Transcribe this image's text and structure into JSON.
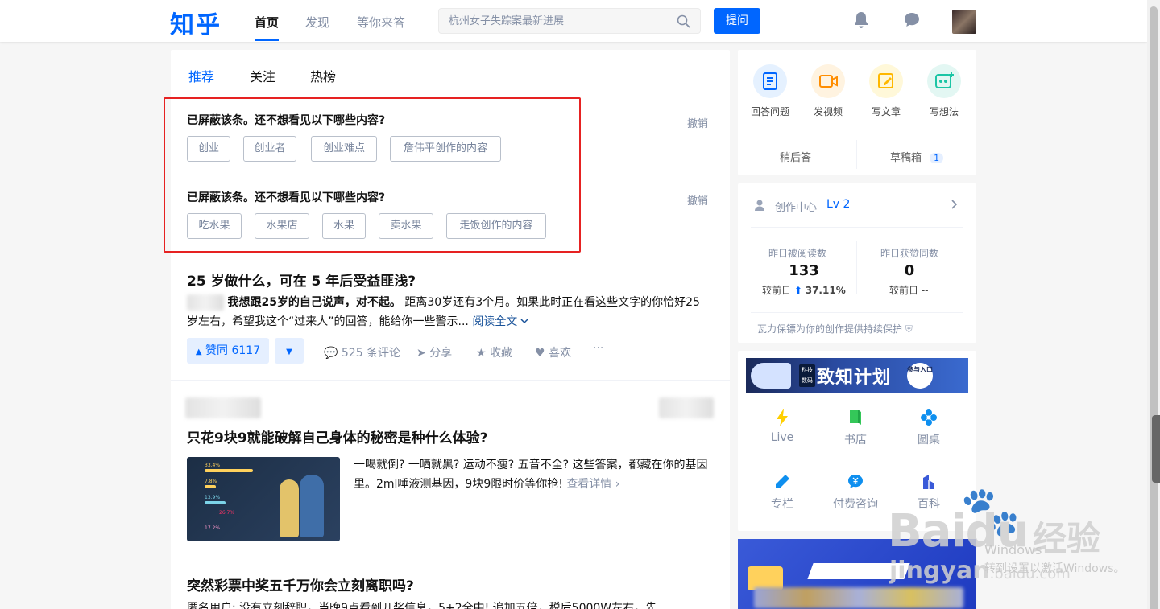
{
  "header": {
    "logo": "知乎",
    "nav": [
      "首页",
      "发现",
      "等你来答"
    ],
    "search_placeholder": "杭州女子失踪案最新进展",
    "ask_label": "提问",
    "icons": [
      "search-icon",
      "bell-icon",
      "chat-icon"
    ]
  },
  "feed": {
    "tabs": [
      "推荐",
      "关注",
      "热榜"
    ],
    "blocked": [
      {
        "title": "已屏蔽该条。还不想看见以下哪些内容?",
        "undo": "撤销",
        "chips": [
          "创业",
          "创业者",
          "创业难点",
          "詹伟平创作的内容"
        ]
      },
      {
        "title": "已屏蔽该条。还不想看见以下哪些内容?",
        "undo": "撤销",
        "chips": [
          "吃水果",
          "水果店",
          "水果",
          "卖水果",
          "走饭创作的内容"
        ]
      }
    ],
    "items": [
      {
        "title": "25 岁做什么，可在 5 年后受益匪浅?",
        "excerpt_bold": "我想跟25岁的自己说声，对不起。",
        "excerpt": " 距离30岁还有3个月。如果此时正在看这些文字的你恰好25岁左右，希望我这个“过来人”的回答，能给你一些警示...",
        "read_more": "阅读全文",
        "vote": "赞同 6117",
        "comments": "525 条评论",
        "share": "分享",
        "collect": "收藏",
        "like": "喜欢",
        "more": "···"
      },
      {
        "title": "只花9块9就能破解自己身体的秘密是种什么体验?",
        "excerpt": "一喝就倒? 一晒就黑? 运动不瘦? 五音不全? 这些答案，都藏在你的基因里。2ml唾液测基因，9块9限时价等你抢! ",
        "detail": "查看详情",
        "thumb_stats": [
          "33.4%",
          "7.8%",
          "13.9%",
          "26.7%",
          "17.2%"
        ]
      },
      {
        "title": "突然彩票中奖五千万你会立刻离职吗?",
        "excerpt": "匿名用户: 没有立刻辞职，当晚9点看到开奖信息，5+2全中! 追加五倍，税后5000W左右，先"
      }
    ]
  },
  "sidebar": {
    "tools": [
      {
        "label": "回答问题",
        "color": "#e5f1ff",
        "icon": "answer-icon"
      },
      {
        "label": "发视频",
        "color": "#fff3e0",
        "icon": "video-icon"
      },
      {
        "label": "写文章",
        "color": "#fff8d9",
        "icon": "edit-icon"
      },
      {
        "label": "写想法",
        "color": "#e3f7f3",
        "icon": "idea-icon"
      }
    ],
    "later": "稍后答",
    "drafts": "草稿箱",
    "drafts_count": "1",
    "creator": {
      "label": "创作中心",
      "level": "Lv 2",
      "reads_label": "昨日被阅读数",
      "reads": "133",
      "reads_cmp_label": "较前日",
      "reads_cmp": "37.11%",
      "likes_label": "昨日获赞同数",
      "likes": "0",
      "likes_cmp_label": "较前日",
      "likes_cmp": "--",
      "protect": "瓦力保镖为你的创作提供持续保护"
    },
    "banner": {
      "tag": "科技数码",
      "text": "致知计划",
      "cta": "参与入口"
    },
    "grid": [
      {
        "label": "Live",
        "icon": "lightning-icon",
        "color": "#ffcf00"
      },
      {
        "label": "书店",
        "icon": "book-icon",
        "color": "#34c759"
      },
      {
        "label": "圆桌",
        "icon": "roundtable-icon",
        "color": "#0e8fef"
      },
      {
        "label": "专栏",
        "icon": "pen-icon",
        "color": "#0e8fef"
      },
      {
        "label": "付费咨询",
        "icon": "paid-consult-icon",
        "color": "#0e8fef"
      },
      {
        "label": "百科",
        "icon": "wiki-icon",
        "color": "#3a5ad8"
      }
    ]
  },
  "watermark": {
    "brand": "Bai",
    "brand2": "du",
    "jing": "经验",
    "sub": "jingyan",
    "sub_tail": ".baidu.com"
  },
  "os_overlay": {
    "line1": "Windows",
    "line2": "转到设置以激活Windows。"
  },
  "colors": {
    "brand": "#0066ff",
    "highlight": "#e62222"
  }
}
